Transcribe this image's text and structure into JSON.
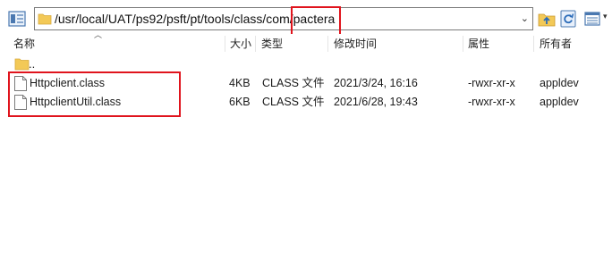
{
  "address": {
    "path_prefix": "/usr/local/UAT/ps92/psft/pt/tools/class/com/",
    "path_last": "pactera",
    "dropdown_glyph": "⌄"
  },
  "toolbar": {
    "view_icon": "view-toggle-icon",
    "up_icon": "parent-folder-icon",
    "refresh_icon": "refresh-icon",
    "layout_icon": "list-layout-icon"
  },
  "columns": {
    "name": "名称",
    "size": "大小",
    "type": "类型",
    "modified": "修改时间",
    "attributes": "属性",
    "owner": "所有者"
  },
  "parent_row": {
    "name": ".."
  },
  "files": [
    {
      "name": "Httpclient.class",
      "size": "4KB",
      "type": "CLASS 文件",
      "modified": "2021/3/24, 16:16",
      "attributes": "-rwxr-xr-x",
      "owner": "appldev"
    },
    {
      "name": "HttpclientUtil.class",
      "size": "6KB",
      "type": "CLASS 文件",
      "modified": "2021/6/28, 19:43",
      "attributes": "-rwxr-xr-x",
      "owner": "appldev"
    }
  ],
  "colors": {
    "highlight": "#e0141d",
    "folder": "#f3c957"
  }
}
